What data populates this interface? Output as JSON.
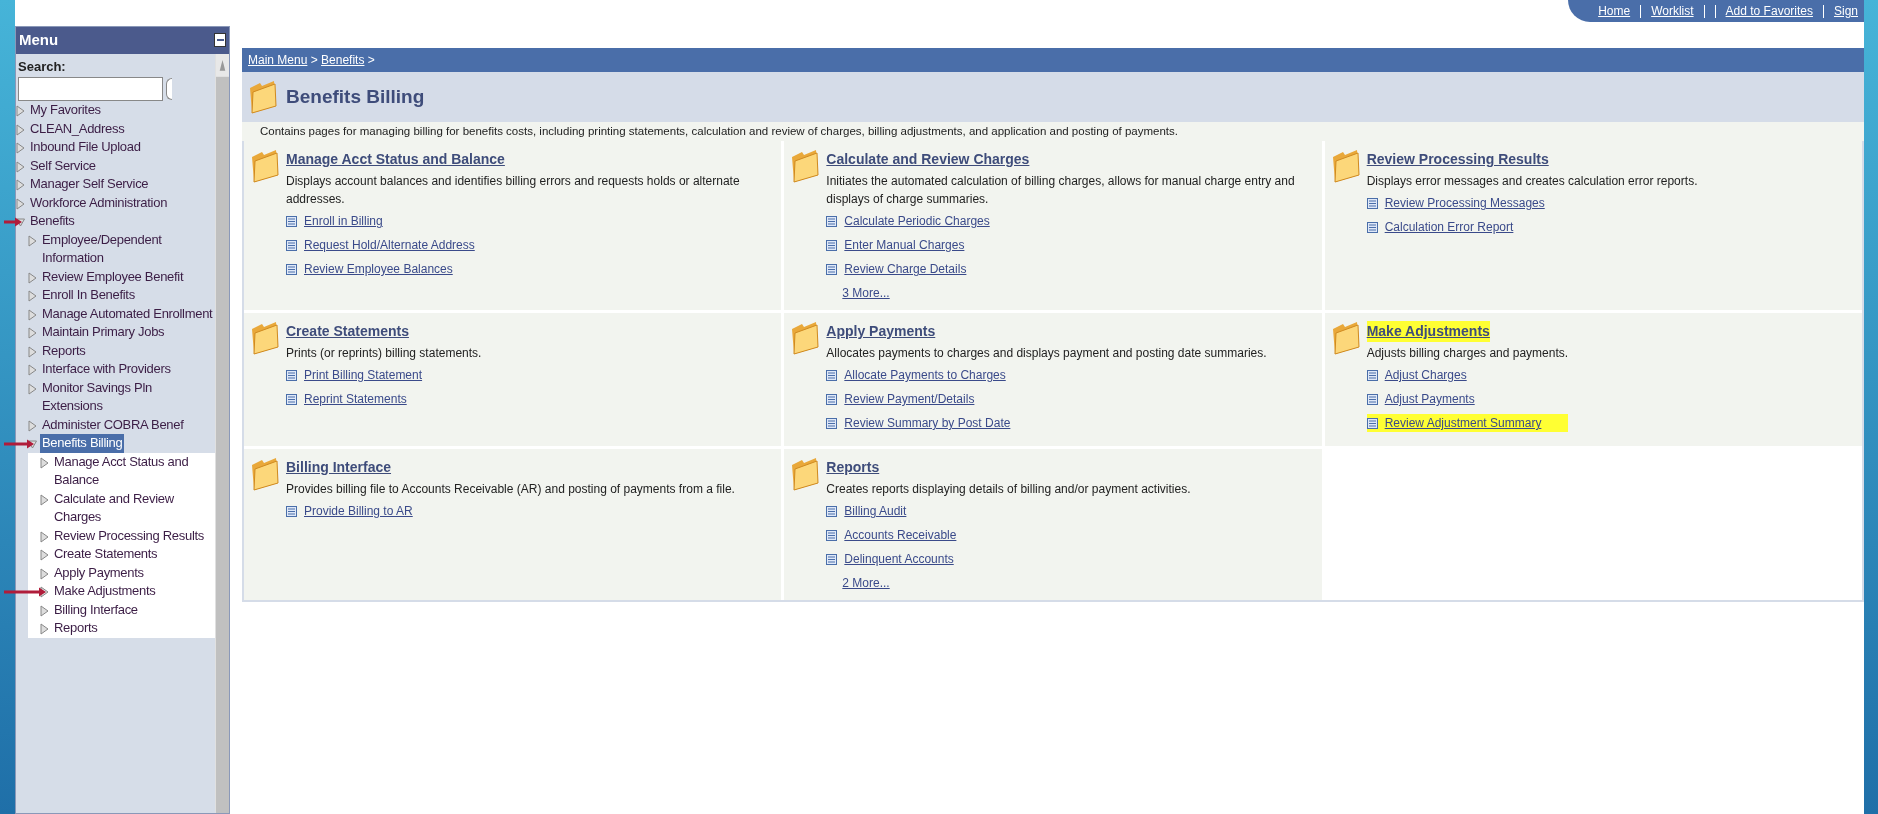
{
  "top_links": [
    {
      "kind": "link",
      "label": "Home"
    },
    {
      "kind": "separator"
    },
    {
      "kind": "link",
      "label": "Worklist"
    },
    {
      "kind": "separator"
    },
    {
      "kind": "separator"
    },
    {
      "kind": "link",
      "label": "Add to Favorites"
    },
    {
      "kind": "separator"
    },
    {
      "kind": "link",
      "label": "Sign"
    }
  ],
  "sidebar": {
    "title": "Menu",
    "search_label": "Search:",
    "items": [
      {
        "label": "My Favorites",
        "expanded": false,
        "selected": false,
        "arrow": false
      },
      {
        "label": "CLEAN_Address",
        "expanded": false,
        "selected": false,
        "arrow": false
      },
      {
        "label": "Inbound File Upload",
        "expanded": false,
        "selected": false,
        "arrow": false
      },
      {
        "label": "Self Service",
        "expanded": false,
        "selected": false,
        "arrow": false
      },
      {
        "label": "Manager Self Service",
        "expanded": false,
        "selected": false,
        "arrow": false
      },
      {
        "label": "Workforce Administration",
        "expanded": false,
        "selected": false,
        "arrow": false
      },
      {
        "label": "Benefits",
        "expanded": true,
        "selected": false,
        "arrow": true,
        "children": [
          {
            "label": "Employee/Dependent Information",
            "expanded": false,
            "selected": false,
            "arrow": false
          },
          {
            "label": "Review Employee Benefit",
            "expanded": false,
            "selected": false,
            "arrow": false
          },
          {
            "label": "Enroll In Benefits",
            "expanded": false,
            "selected": false,
            "arrow": false
          },
          {
            "label": "Manage Automated Enrollment",
            "expanded": false,
            "selected": false,
            "arrow": false
          },
          {
            "label": "Maintain Primary Jobs",
            "expanded": false,
            "selected": false,
            "arrow": false
          },
          {
            "label": "Reports",
            "expanded": false,
            "selected": false,
            "arrow": false
          },
          {
            "label": "Interface with Providers",
            "expanded": false,
            "selected": false,
            "arrow": false
          },
          {
            "label": "Monitor Savings Pln Extensions",
            "expanded": false,
            "selected": false,
            "arrow": false
          },
          {
            "label": "Administer COBRA Benef",
            "expanded": false,
            "selected": false,
            "arrow": false
          },
          {
            "label": "Benefits Billing",
            "expanded": true,
            "selected": true,
            "arrow": true,
            "children": [
              {
                "label": "Manage Acct Status and Balance",
                "expanded": false,
                "selected": false,
                "arrow": false
              },
              {
                "label": "Calculate and Review Charges",
                "expanded": false,
                "selected": false,
                "arrow": false
              },
              {
                "label": "Review Processing Results",
                "expanded": false,
                "selected": false,
                "arrow": false
              },
              {
                "label": "Create Statements",
                "expanded": false,
                "selected": false,
                "arrow": false
              },
              {
                "label": "Apply Payments",
                "expanded": false,
                "selected": false,
                "arrow": false
              },
              {
                "label": "Make Adjustments",
                "expanded": false,
                "selected": false,
                "arrow": true
              },
              {
                "label": "Billing Interface",
                "expanded": false,
                "selected": false,
                "arrow": false
              },
              {
                "label": "Reports",
                "expanded": false,
                "selected": false,
                "arrow": false
              }
            ]
          }
        ]
      }
    ]
  },
  "breadcrumb": {
    "items": [
      "Main Menu",
      "Benefits"
    ],
    "separator": ">"
  },
  "page_title": "Benefits Billing",
  "description": "Contains pages for managing billing for benefits costs, including printing statements, calculation and review of charges, billing adjustments, and application and posting of payments.",
  "sections": [
    {
      "title": "Manage Acct Status and Balance",
      "highlighted": false,
      "description": "Displays account balances and identifies billing errors and requests holds or alternate addresses.",
      "links": [
        {
          "label": "Enroll in Billing",
          "highlighted": false
        },
        {
          "label": "Request Hold/Alternate Address",
          "highlighted": false
        },
        {
          "label": "Review Employee Balances",
          "highlighted": false
        }
      ]
    },
    {
      "title": "Calculate and Review Charges",
      "highlighted": false,
      "description": "Initiates the automated calculation of billing charges, allows for manual charge entry and displays of charge summaries.",
      "links": [
        {
          "label": "Calculate Periodic Charges",
          "highlighted": false
        },
        {
          "label": "Enter Manual Charges",
          "highlighted": false
        },
        {
          "label": "Review Charge Details",
          "highlighted": false
        }
      ],
      "more": "3 More..."
    },
    {
      "title": "Review Processing Results",
      "highlighted": false,
      "description": "Displays error messages and creates calculation error reports.",
      "links": [
        {
          "label": "Review Processing Messages",
          "highlighted": false
        },
        {
          "label": "Calculation Error Report",
          "highlighted": false
        }
      ]
    },
    {
      "title": "Create Statements",
      "highlighted": false,
      "description": "Prints (or reprints) billing statements.",
      "links": [
        {
          "label": "Print Billing Statement",
          "highlighted": false
        },
        {
          "label": "Reprint Statements",
          "highlighted": false
        }
      ]
    },
    {
      "title": "Apply Payments",
      "highlighted": false,
      "description": "Allocates payments to charges and displays payment and posting date summaries.",
      "links": [
        {
          "label": "Allocate Payments to Charges",
          "highlighted": false
        },
        {
          "label": "Review Payment/Details",
          "highlighted": false
        },
        {
          "label": "Review Summary by Post Date",
          "highlighted": false
        }
      ]
    },
    {
      "title": "Make Adjustments",
      "highlighted": true,
      "description": "Adjusts billing charges and payments.",
      "links": [
        {
          "label": "Adjust Charges",
          "highlighted": false
        },
        {
          "label": "Adjust Payments",
          "highlighted": false
        },
        {
          "label": "Review Adjustment Summary",
          "highlighted": true
        }
      ]
    },
    {
      "title": "Billing Interface",
      "highlighted": false,
      "description": "Provides billing file to Accounts Receivable (AR) and posting of payments from a file.",
      "links": [
        {
          "label": "Provide Billing to AR",
          "highlighted": false
        }
      ]
    },
    {
      "title": "Reports",
      "highlighted": false,
      "description": "Creates reports displaying details of billing and/or payment activities.",
      "links": [
        {
          "label": "Billing Audit",
          "highlighted": false
        },
        {
          "label": "Accounts Receivable",
          "highlighted": false
        },
        {
          "label": "Delinquent Accounts",
          "highlighted": false
        }
      ],
      "more": "2 More..."
    }
  ]
}
